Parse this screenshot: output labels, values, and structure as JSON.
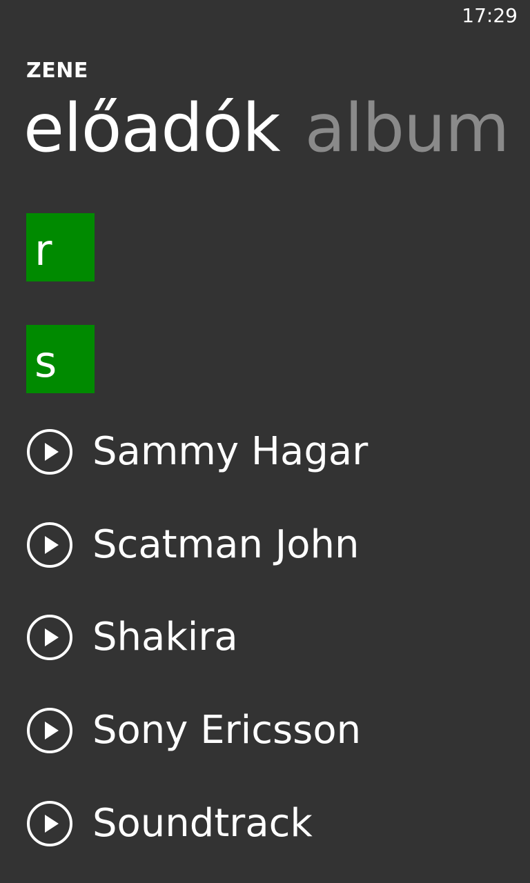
{
  "status_bar": {
    "time": "17:29"
  },
  "app": {
    "title": "ZENE"
  },
  "pivot": {
    "tabs": [
      {
        "label": "előadók",
        "active": true
      },
      {
        "label": "album",
        "active": false
      }
    ]
  },
  "accent_color": "#008a00",
  "letter_groups": [
    "r",
    "s"
  ],
  "artists": [
    {
      "name": "Sammy Hagar",
      "icon": "play-circle-icon"
    },
    {
      "name": "Scatman John",
      "icon": "play-circle-icon"
    },
    {
      "name": "Shakira",
      "icon": "play-circle-icon"
    },
    {
      "name": "Sony Ericsson",
      "icon": "play-circle-icon"
    },
    {
      "name": "Soundtrack",
      "icon": "play-circle-icon"
    }
  ]
}
